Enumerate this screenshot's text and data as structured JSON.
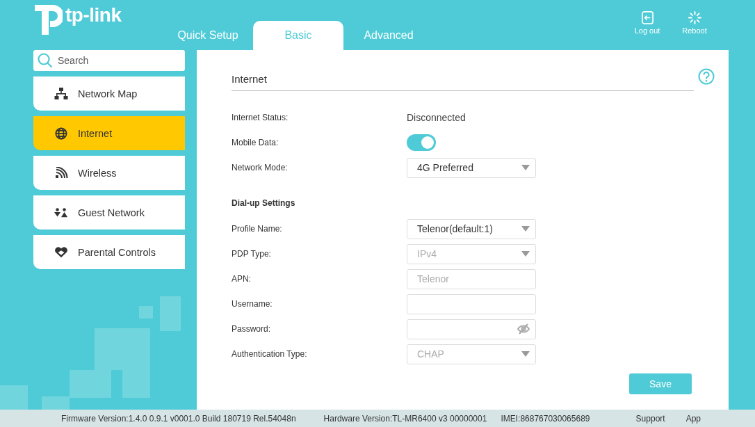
{
  "brand": {
    "name": "tp-link"
  },
  "tabs": [
    {
      "label": "Quick Setup",
      "selected": false
    },
    {
      "label": "Basic",
      "selected": true
    },
    {
      "label": "Advanced",
      "selected": false
    }
  ],
  "header_actions": [
    {
      "label": "Log out",
      "kind": "logout"
    },
    {
      "label": "Reboot",
      "kind": "reboot"
    }
  ],
  "sidebar": {
    "search": {
      "placeholder": "Search"
    },
    "items": [
      {
        "label": "Network Map",
        "selected": false
      },
      {
        "label": "Internet",
        "selected": true
      },
      {
        "label": "Wireless",
        "selected": false
      },
      {
        "label": "Guest Network",
        "selected": false
      },
      {
        "label": "Parental Controls",
        "selected": false
      }
    ]
  },
  "panel": {
    "title": "Internet",
    "fields": [
      {
        "kind": "text",
        "label": "Internet Status:",
        "value": "Disconnected"
      },
      {
        "kind": "toggle",
        "label": "Mobile Data:",
        "on": true
      },
      {
        "kind": "select",
        "label": "Network Mode:",
        "value": "4G Preferred",
        "disabled": false
      },
      {
        "kind": "heading",
        "label": "Dial-up Settings"
      },
      {
        "kind": "select",
        "label": "Profile Name:",
        "value": "Telenor(default:1)",
        "disabled": false
      },
      {
        "kind": "select",
        "label": "PDP Type:",
        "value": "IPv4",
        "disabled": true
      },
      {
        "kind": "input",
        "label": "APN:",
        "value": "Telenor",
        "disabled": true
      },
      {
        "kind": "input",
        "label": "Username:"
      },
      {
        "kind": "password",
        "label": "Password:"
      },
      {
        "kind": "select",
        "label": "Authentication Type:",
        "value": "CHAP",
        "disabled": true
      }
    ],
    "save_button": "Save"
  },
  "footer": {
    "firmware": "Firmware Version:1.4.0 0.9.1 v0001.0 Build 180719 Rel.54048n",
    "hardware": "Hardware Version:TL-MR6400 v3 00000001",
    "imei": "IMEI:868767030065689",
    "links": [
      "Support",
      "App"
    ]
  }
}
